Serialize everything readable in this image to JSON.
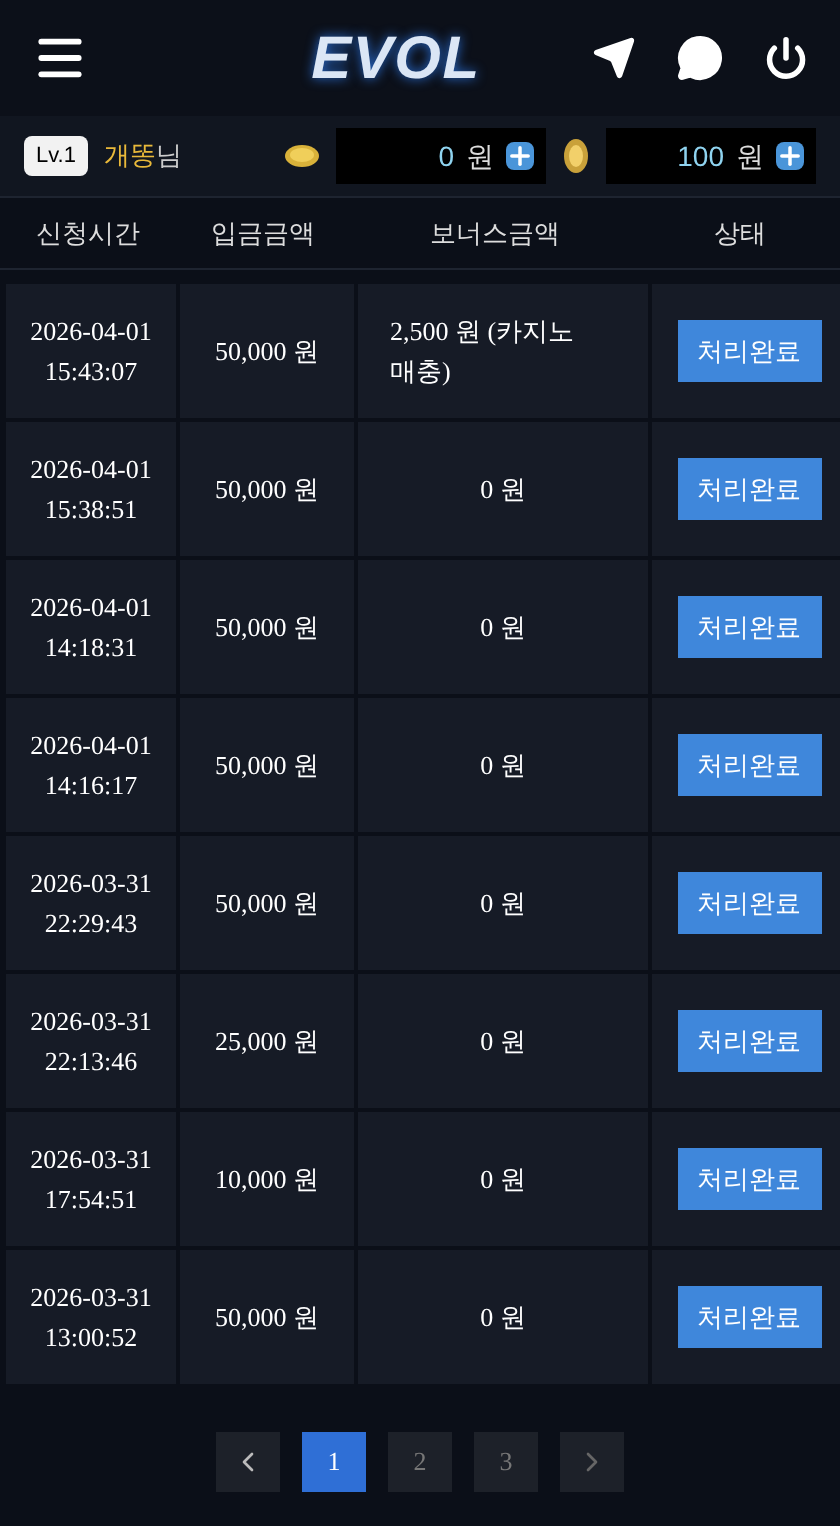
{
  "header": {
    "logo": "EVOL"
  },
  "user": {
    "level": "Lv.1",
    "name": "개똥",
    "suffix": "님",
    "balances": [
      {
        "kind": "coin",
        "amount": "0",
        "unit": "원"
      },
      {
        "kind": "chip",
        "amount": "100",
        "unit": "원"
      }
    ]
  },
  "table": {
    "columns": [
      "신청시간",
      "입금금액",
      "보너스금액",
      "상태"
    ],
    "rows": [
      {
        "date": "2026-04-01",
        "time": "15:43:07",
        "amount": "50,000 원",
        "bonus": "2,500 원 (카지노 매충)",
        "status": "처리완료"
      },
      {
        "date": "2026-04-01",
        "time": "15:38:51",
        "amount": "50,000 원",
        "bonus": "0 원",
        "status": "처리완료"
      },
      {
        "date": "2026-04-01",
        "time": "14:18:31",
        "amount": "50,000 원",
        "bonus": "0 원",
        "status": "처리완료"
      },
      {
        "date": "2026-04-01",
        "time": "14:16:17",
        "amount": "50,000 원",
        "bonus": "0 원",
        "status": "처리완료"
      },
      {
        "date": "2026-03-31",
        "time": "22:29:43",
        "amount": "50,000 원",
        "bonus": "0 원",
        "status": "처리완료"
      },
      {
        "date": "2026-03-31",
        "time": "22:13:46",
        "amount": "25,000 원",
        "bonus": "0 원",
        "status": "처리완료"
      },
      {
        "date": "2026-03-31",
        "time": "17:54:51",
        "amount": "10,000 원",
        "bonus": "0 원",
        "status": "처리완료"
      },
      {
        "date": "2026-03-31",
        "time": "13:00:52",
        "amount": "50,000 원",
        "bonus": "0 원",
        "status": "처리완료"
      }
    ]
  },
  "pagination": {
    "pages": [
      {
        "label": "1",
        "selected": true
      },
      {
        "label": "2",
        "selected": false
      },
      {
        "label": "3",
        "selected": false
      }
    ]
  }
}
